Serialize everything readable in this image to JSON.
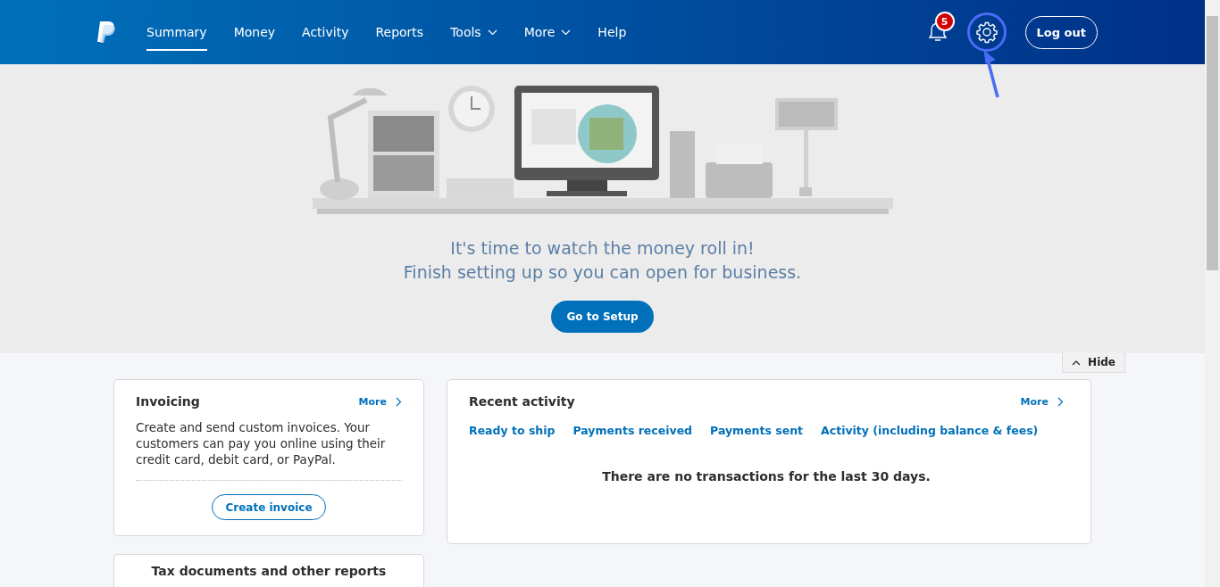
{
  "nav": {
    "items": [
      {
        "label": "Summary",
        "selected": true,
        "dropdown": false
      },
      {
        "label": "Money",
        "selected": false,
        "dropdown": false
      },
      {
        "label": "Activity",
        "selected": false,
        "dropdown": false
      },
      {
        "label": "Reports",
        "selected": false,
        "dropdown": false
      },
      {
        "label": "Tools",
        "selected": false,
        "dropdown": true
      },
      {
        "label": "More",
        "selected": false,
        "dropdown": true
      },
      {
        "label": "Help",
        "selected": false,
        "dropdown": false
      }
    ],
    "notification_count": "5",
    "settings_highlighted": true,
    "logout": "Log out"
  },
  "hero": {
    "headline": "It's time to watch the money roll in!",
    "subline": "Finish setting up so you can open for business.",
    "button": "Go to Setup",
    "hide": "Hide"
  },
  "invoicing": {
    "title": "Invoicing",
    "more": "More",
    "text": "Create and send custom invoices. Your customers can pay you online using their credit card, debit card, or PayPal.",
    "button": "Create invoice"
  },
  "tax_card": {
    "title": "Tax documents and other reports"
  },
  "recent_activity": {
    "title": "Recent activity",
    "more": "More",
    "links": [
      "Ready to ship",
      "Payments received",
      "Payments sent",
      "Activity (including balance & fees)"
    ],
    "empty": "There are no transactions for the last 30 days."
  }
}
